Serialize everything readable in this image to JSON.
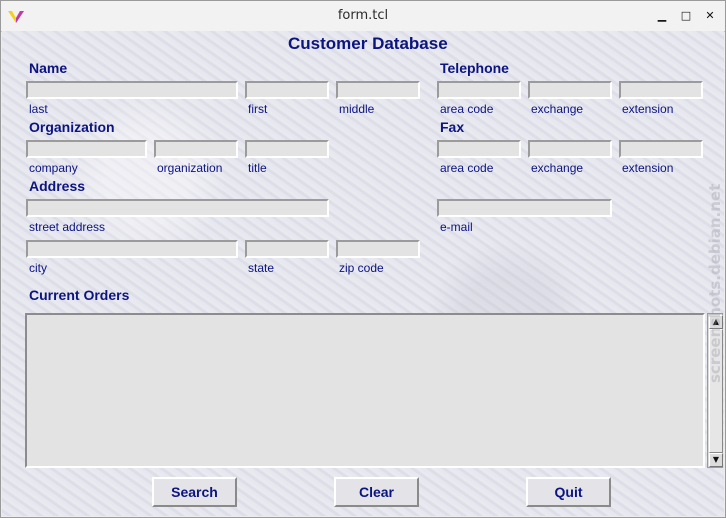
{
  "window": {
    "title": "form.tcl",
    "minimize_glyph": "▁",
    "maximize_glyph": "□",
    "close_glyph": "✕"
  },
  "form": {
    "heading": "Customer Database",
    "name": {
      "title": "Name",
      "last": "last",
      "first": "first",
      "middle": "middle"
    },
    "telephone": {
      "title": "Telephone",
      "area_code": "area code",
      "exchange": "exchange",
      "extension": "extension"
    },
    "organization": {
      "title": "Organization",
      "company": "company",
      "organization": "organization",
      "title_field": "title"
    },
    "fax": {
      "title": "Fax",
      "area_code": "area code",
      "exchange": "exchange",
      "extension": "extension"
    },
    "address": {
      "title": "Address",
      "street": "street address",
      "email": "e-mail",
      "city": "city",
      "state": "state",
      "zip": "zip code"
    },
    "orders": {
      "title": "Current Orders"
    }
  },
  "buttons": {
    "search": "Search",
    "clear": "Clear",
    "quit": "Quit"
  },
  "watermark": "screenshots.debian.net",
  "colors": {
    "label_blue": "#0c1480",
    "entry_bg": "#e3e3e3",
    "window_bg": "#ececec"
  }
}
